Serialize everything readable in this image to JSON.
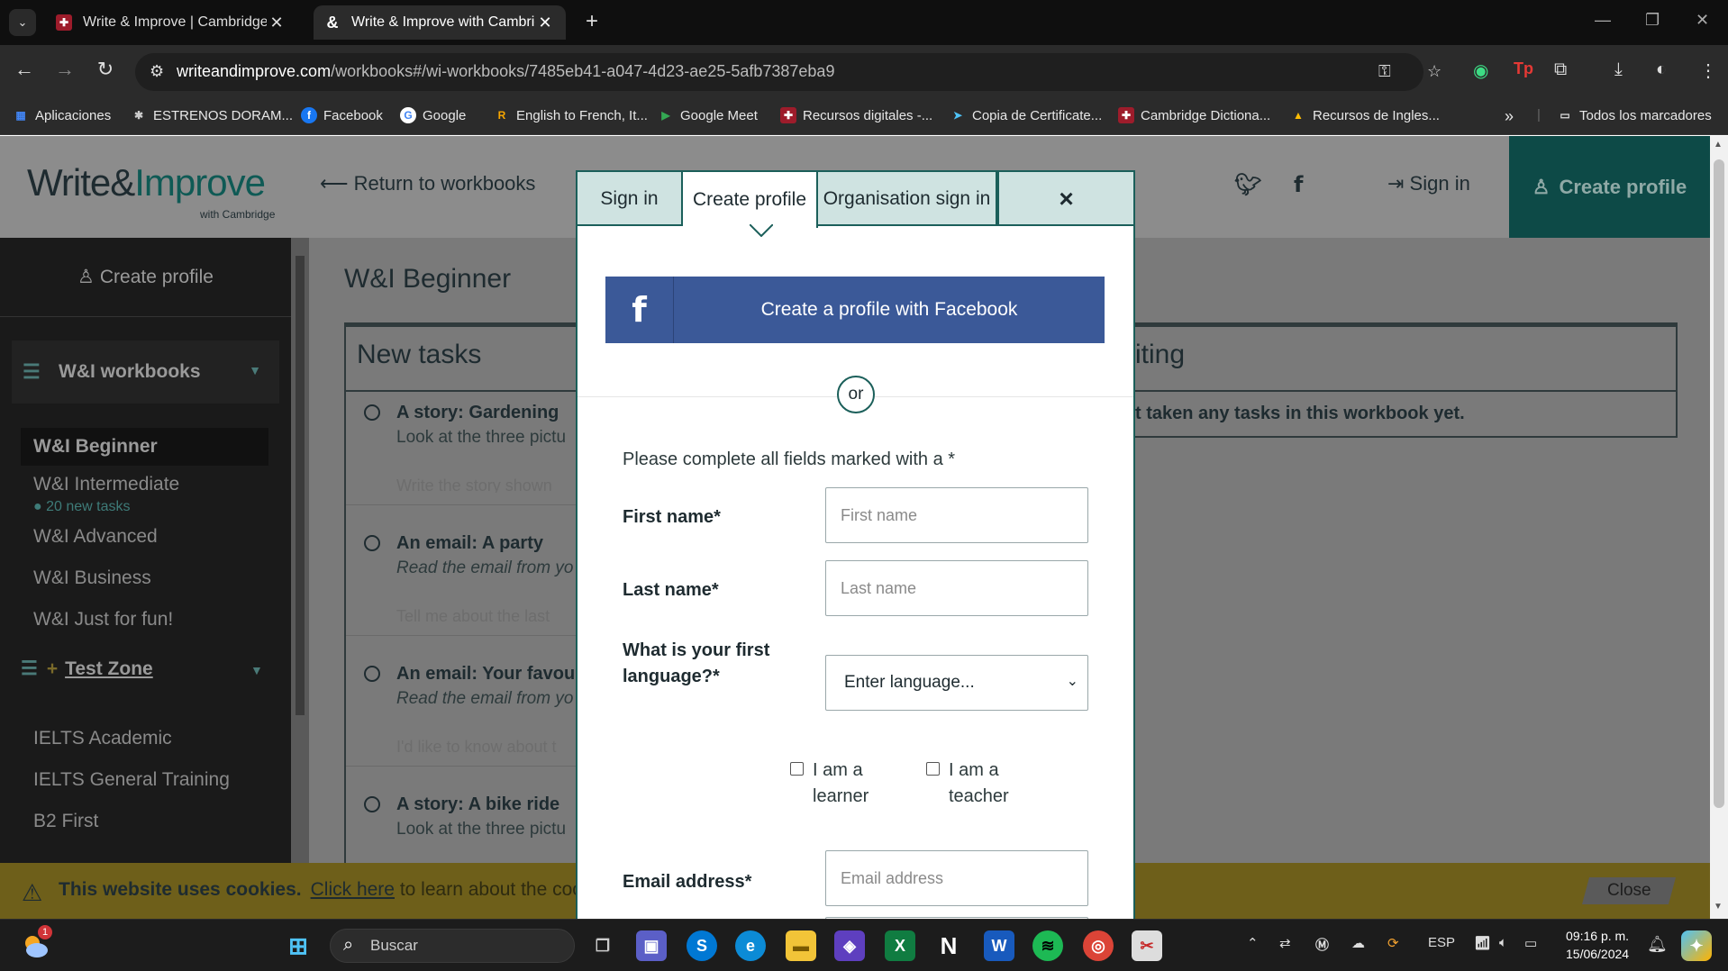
{
  "browser": {
    "tabs": [
      {
        "title": "Write & Improve | Cambridge E",
        "active": false
      },
      {
        "title": "Write & Improve with Cambridge",
        "active": true
      }
    ],
    "url_host": "writeandimprove.com",
    "url_path": "/workbooks#/wi-workbooks/7485eb41-a047-4d23-ae25-5afb7387eba9",
    "bookmarks": [
      "Aplicaciones",
      "ESTRENOS DORAM...",
      "Facebook",
      "Google",
      "English to French, It...",
      "Google Meet",
      "Recursos digitales -...",
      "Copia de Certificate...",
      "Cambridge Dictiona...",
      "Recursos de Ingles..."
    ],
    "all_bookmarks": "Todos los marcadores"
  },
  "header": {
    "logo_main": "Write&",
    "logo_accent": "Improve",
    "logo_sub": "with Cambridge",
    "return_link": "Return to workbooks",
    "sign_in": "Sign in",
    "create_profile": "Create profile"
  },
  "sidebar": {
    "create_profile": "Create profile",
    "group_title": "W&I workbooks",
    "items": [
      "W&I Beginner",
      "W&I Intermediate",
      "W&I Advanced",
      "W&I Business",
      "W&I Just for fun!"
    ],
    "new_tasks_badge": "● 20 new tasks",
    "test_zone": "Test Zone",
    "test_items": [
      "IELTS Academic",
      "IELTS General Training",
      "B2 First"
    ]
  },
  "main": {
    "title": "W&I Beginner",
    "new_tasks_heading": "New tasks",
    "right_heading": "iting",
    "right_empty": "t taken any tasks in this workbook yet.",
    "tasks": [
      {
        "title": "A story: Gardening",
        "desc": "Look at the three pictu",
        "footer": "Write the story shown",
        "italic": false
      },
      {
        "title": "An email: A party",
        "desc": "Read the email from yo",
        "footer": "Tell me about the last",
        "italic": true
      },
      {
        "title": "An email: Your favou",
        "desc": "Read the email from yo",
        "footer": "I'd like to know about t",
        "italic": true
      },
      {
        "title": "A story: A bike ride",
        "desc": "Look at the three pictu",
        "footer": "",
        "italic": false
      }
    ]
  },
  "cookie": {
    "bold": "This website uses cookies.",
    "link": "Click here",
    "rest": "to learn about the cook",
    "close": "Close"
  },
  "modal": {
    "tabs": [
      "Sign in",
      "Create profile",
      "Organisation sign in"
    ],
    "active_tab": "Create profile",
    "close_symbol": "×",
    "facebook_button": "Create a profile with Facebook",
    "or": "or",
    "instructions": "Please complete all fields marked with a *",
    "first_name_label": "First name*",
    "first_name_placeholder": "First name",
    "last_name_label": "Last name*",
    "last_name_placeholder": "Last name",
    "language_label_1": "What is your first",
    "language_label_2": "language?*",
    "language_value": "Enter language...",
    "learner_1": "I am a",
    "learner_2": "learner",
    "teacher_1": "I am a",
    "teacher_2": "teacher",
    "email_label": "Email address*",
    "email_placeholder": "Email address"
  },
  "taskbar": {
    "search": "Buscar",
    "notification_count": "1",
    "language": "ESP",
    "time": "09:16 p. m.",
    "date": "15/06/2024"
  },
  "colors": {
    "brand_teal": "#1b5f5a",
    "facebook_blue": "#3b5998",
    "overlay_grey": "#7a7a7a"
  }
}
